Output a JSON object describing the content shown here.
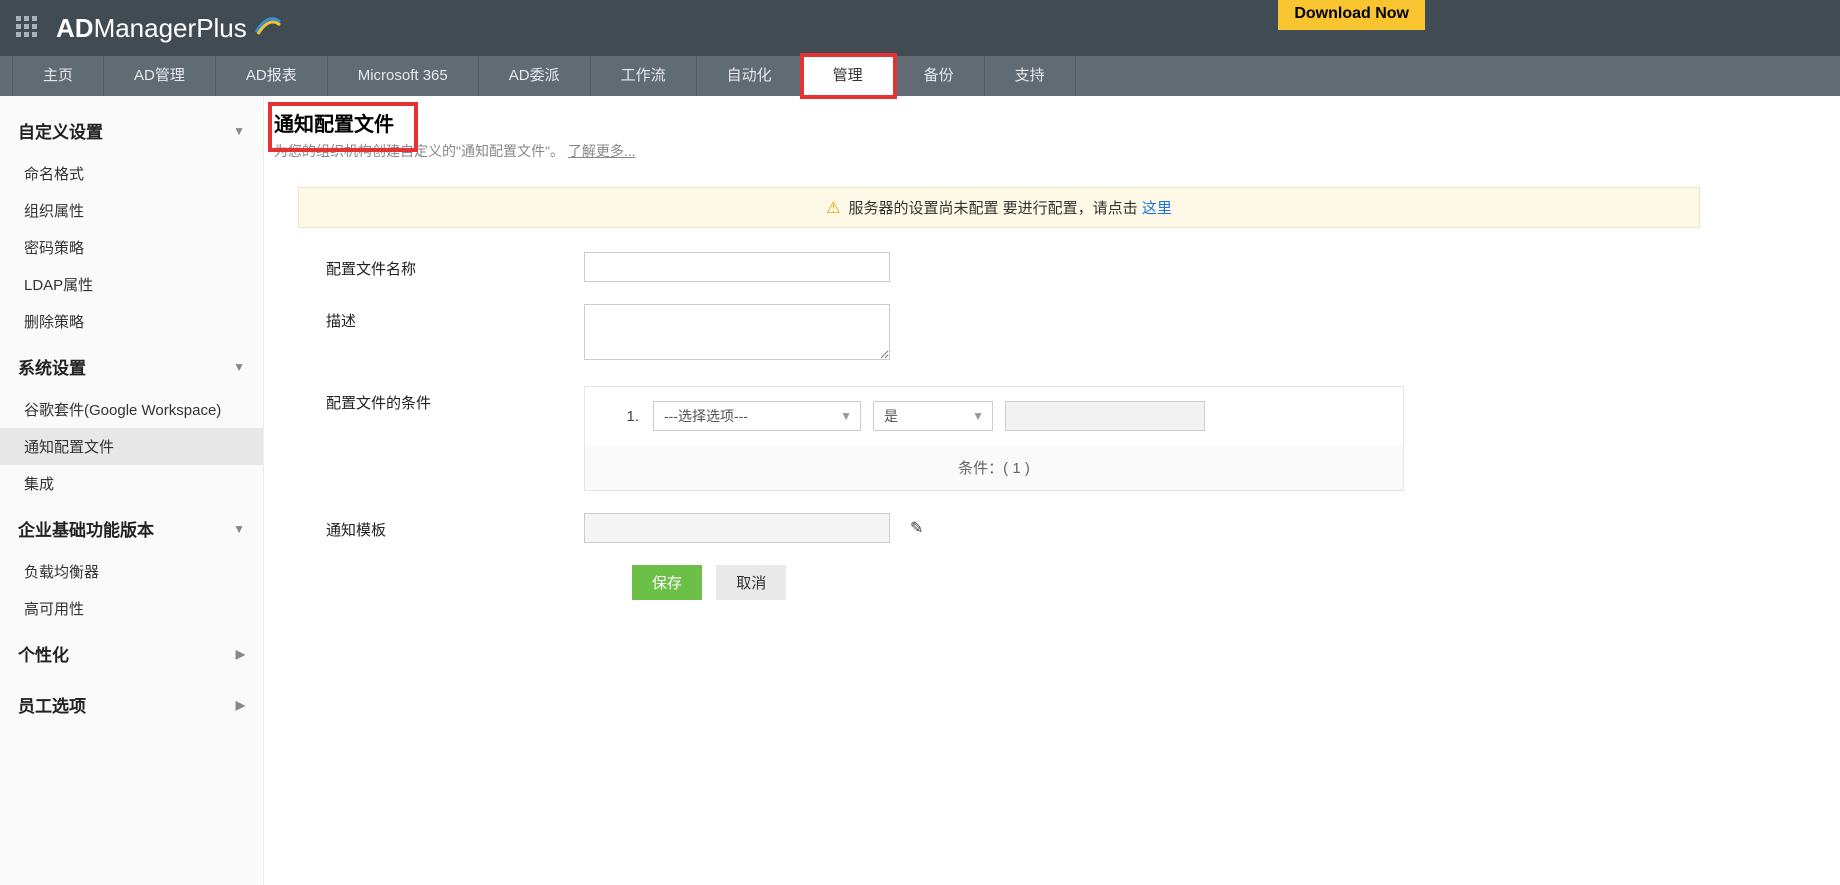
{
  "header": {
    "brand_prefix": "AD",
    "brand_mid": "Manager",
    "brand_suffix": " Plus",
    "download_label": "Download Now"
  },
  "nav": {
    "tabs": [
      {
        "label": "主页"
      },
      {
        "label": "AD管理"
      },
      {
        "label": "AD报表"
      },
      {
        "label": "Microsoft 365"
      },
      {
        "label": "AD委派"
      },
      {
        "label": "工作流"
      },
      {
        "label": "自动化"
      },
      {
        "label": "管理",
        "active": true,
        "highlight": true
      },
      {
        "label": "备份"
      },
      {
        "label": "支持"
      }
    ]
  },
  "sidebar": {
    "groups": [
      {
        "title": "自定义设置",
        "caret": "▼",
        "items": [
          {
            "label": "命名格式"
          },
          {
            "label": "组织属性"
          },
          {
            "label": "密码策略"
          },
          {
            "label": "LDAP属性"
          },
          {
            "label": "删除策略"
          }
        ]
      },
      {
        "title": "系统设置",
        "caret": "▼",
        "items": [
          {
            "label": "谷歌套件(Google Workspace)"
          },
          {
            "label": "通知配置文件",
            "active": true
          },
          {
            "label": "集成"
          }
        ]
      },
      {
        "title": "企业基础功能版本",
        "caret": "▼",
        "items": [
          {
            "label": "负载均衡器"
          },
          {
            "label": "高可用性"
          }
        ]
      },
      {
        "title": "个性化",
        "caret": "▶",
        "items": []
      },
      {
        "title": "员工选项",
        "caret": "▶",
        "items": []
      }
    ]
  },
  "page": {
    "title": "通知配置文件",
    "subtitle_prefix": "为您的组织机构创建自定义的\"通知配置文件\"。   ",
    "learn_more": "了解更多..."
  },
  "notice": {
    "text_prefix": "服务器的设置尚未配置 要进行配置，请点击 ",
    "link": "这里"
  },
  "form": {
    "profile_name_label": "配置文件名称",
    "description_label": "描述",
    "conditions_label": "配置文件的条件",
    "condition_number": "1.",
    "condition_select_placeholder": "---选择选项---",
    "condition_operator_value": "是",
    "condition_footer": "条件：( 1 )",
    "template_label": "通知模板",
    "save_label": "保存",
    "cancel_label": "取消"
  }
}
